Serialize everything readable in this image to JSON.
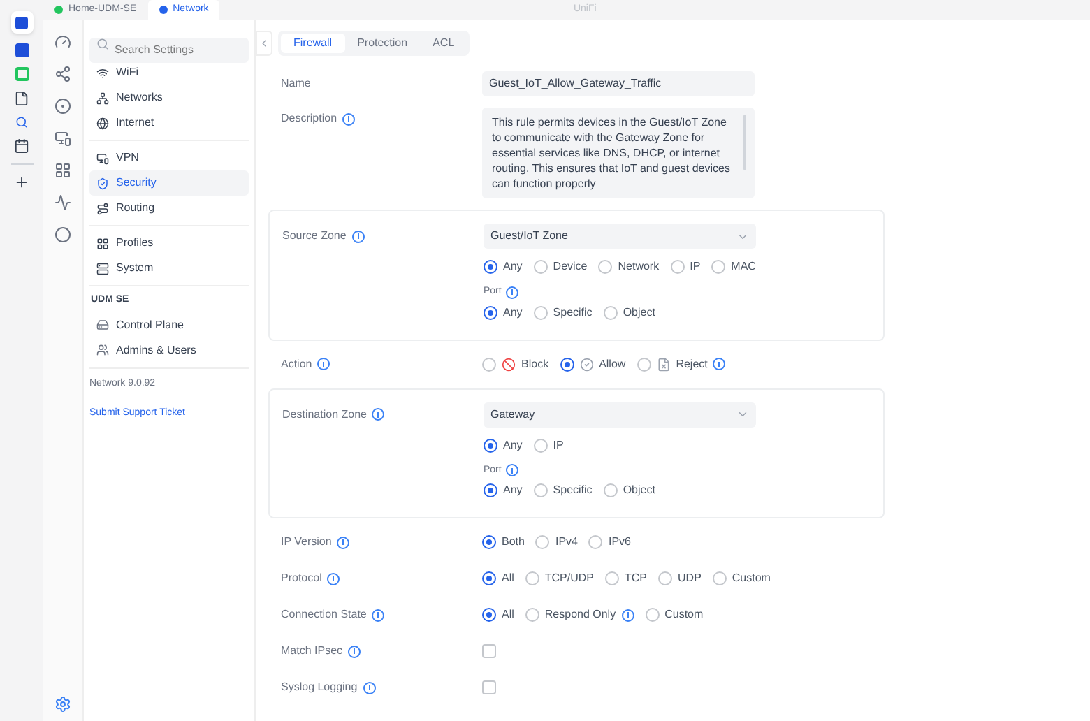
{
  "top_bar": {
    "tabs": [
      {
        "label": "Home-UDM-SE",
        "selected": false
      },
      {
        "label": "Network",
        "selected": true
      }
    ],
    "title": "UniFi"
  },
  "nav": {
    "search": {
      "placeholder": "Search Settings"
    },
    "groups": [
      {
        "items": [
          {
            "label": "WiFi",
            "selected": false
          },
          {
            "label": "Networks",
            "selected": false
          },
          {
            "label": "Internet",
            "selected": false
          }
        ]
      },
      {
        "items": [
          {
            "label": "VPN",
            "selected": false
          },
          {
            "label": "Security",
            "selected": true
          },
          {
            "label": "Routing",
            "selected": false
          }
        ]
      },
      {
        "items": [
          {
            "label": "Profiles",
            "selected": false
          },
          {
            "label": "System",
            "selected": false
          }
        ]
      }
    ],
    "device": {
      "title": "UDM SE",
      "items": [
        {
          "label": "Control Plane",
          "selected": false
        },
        {
          "label": "Admins & Users",
          "selected": false
        }
      ]
    },
    "version": "Network 9.0.92",
    "support_link": "Submit Support Ticket"
  },
  "tabs": [
    {
      "label": "Firewall",
      "selected": true
    },
    {
      "label": "Protection",
      "selected": false
    },
    {
      "label": "ACL",
      "selected": false
    }
  ],
  "form": [
    {
      "kind": "text",
      "label": "Name",
      "value": "Guest_IoT_Allow_Gateway_Traffic"
    },
    {
      "kind": "textarea",
      "label": "Description",
      "info": true,
      "value": "This rule permits devices in the Guest/IoT Zone to communicate with the Gateway Zone for essential services like DNS, DHCP, or internet routing. This ensures that IoT and guest devices can function properly"
    },
    {
      "kind": "zone",
      "label": "Source Zone",
      "info": true,
      "select": "Guest/IoT Zone",
      "options": [
        {
          "label": "Any",
          "selected": true
        },
        {
          "label": "Device",
          "selected": false
        },
        {
          "label": "Network",
          "selected": false
        },
        {
          "label": "IP",
          "selected": false
        },
        {
          "label": "MAC",
          "selected": false
        }
      ],
      "port_label": "Port",
      "port_info": true,
      "port_options": [
        {
          "label": "Any",
          "selected": true
        },
        {
          "label": "Specific",
          "selected": false
        },
        {
          "label": "Object",
          "selected": false
        }
      ]
    },
    {
      "kind": "radio",
      "label": "Action",
      "info": true,
      "options": [
        {
          "label": "Block",
          "selected": false,
          "kind": "block"
        },
        {
          "label": "Allow",
          "selected": true,
          "kind": "allow"
        },
        {
          "label": "Reject",
          "selected": false,
          "kind": "reject",
          "info": true
        }
      ]
    },
    {
      "kind": "zone",
      "label": "Destination Zone",
      "info": true,
      "select": "Gateway",
      "options": [
        {
          "label": "Any",
          "selected": true
        },
        {
          "label": "IP",
          "selected": false
        }
      ],
      "port_label": "Port",
      "port_info": true,
      "port_options": [
        {
          "label": "Any",
          "selected": true
        },
        {
          "label": "Specific",
          "selected": false
        },
        {
          "label": "Object",
          "selected": false
        }
      ]
    },
    {
      "kind": "radio",
      "label": "IP Version",
      "info": true,
      "options": [
        {
          "label": "Both",
          "selected": true
        },
        {
          "label": "IPv4",
          "selected": false
        },
        {
          "label": "IPv6",
          "selected": false
        }
      ]
    },
    {
      "kind": "radio",
      "label": "Protocol",
      "info": true,
      "options": [
        {
          "label": "All",
          "selected": true
        },
        {
          "label": "TCP/UDP",
          "selected": false
        },
        {
          "label": "TCP",
          "selected": false
        },
        {
          "label": "UDP",
          "selected": false
        },
        {
          "label": "Custom",
          "selected": false
        }
      ]
    },
    {
      "kind": "radio",
      "label": "Connection State",
      "info": true,
      "options": [
        {
          "label": "All",
          "selected": true
        },
        {
          "label": "Respond Only",
          "selected": false,
          "info": true
        },
        {
          "label": "Custom",
          "selected": false
        }
      ]
    },
    {
      "kind": "checkbox",
      "label": "Match IPsec",
      "info": true,
      "checked": false
    },
    {
      "kind": "checkbox",
      "label": "Syslog Logging",
      "info": true,
      "checked": false
    }
  ]
}
